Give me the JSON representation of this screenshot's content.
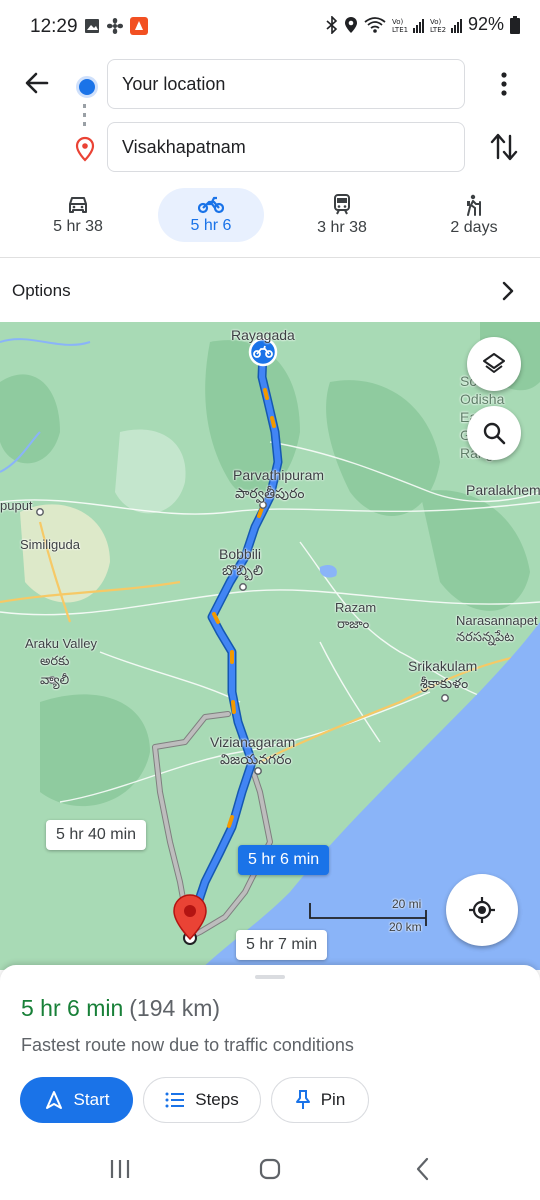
{
  "status_bar": {
    "time": "12:29",
    "battery": "92%",
    "left_icons": [
      "gallery-icon",
      "fan-icon",
      "app-notification-icon"
    ],
    "right_icons": [
      "bluetooth-icon",
      "location-icon",
      "wifi-icon",
      "signal-lte1-icon",
      "signal-lte2-icon",
      "battery-icon"
    ]
  },
  "directions": {
    "origin": "Your location",
    "destination": "Visakhapatnam"
  },
  "modes": [
    {
      "name": "car",
      "icon": "car-icon",
      "time": "5 hr 38",
      "active": false
    },
    {
      "name": "motorcycle",
      "icon": "motorcycle-icon",
      "time": "5 hr 6",
      "active": true
    },
    {
      "name": "transit",
      "icon": "train-icon",
      "time": "3 hr 38",
      "active": false
    },
    {
      "name": "walk",
      "icon": "hiking-icon",
      "time": "2 days",
      "active": false
    }
  ],
  "options": {
    "label": "Options"
  },
  "map": {
    "places": [
      {
        "name": "Rayagada",
        "local": ""
      },
      {
        "name": "Parvathipuram",
        "local": "పార్వతీపురం"
      },
      {
        "name": "Bobbili",
        "local": "బొబ్బిలి"
      },
      {
        "name": "Similiguda",
        "local": ""
      },
      {
        "name": "Araku Valley",
        "local": "అరకు వ్యాలీ"
      },
      {
        "name": "Razam",
        "local": "రాజాం"
      },
      {
        "name": "Narasannapet",
        "local": "నరసన్నపేట"
      },
      {
        "name": "Srikakulam",
        "local": "శ్రీకాకుళం"
      },
      {
        "name": "Vizianagaram",
        "local": "విజయనగరం"
      },
      {
        "name": "Paralakhem",
        "local": ""
      },
      {
        "name": "puput",
        "local": ""
      },
      {
        "name": "South Odisha Eastern Ghats Range",
        "local": ""
      }
    ],
    "route_labels": {
      "alt1": "5 hr 40 min",
      "main": "5 hr 6 min",
      "alt2": "5 hr 7 min"
    },
    "scale": {
      "miles": "20 mi",
      "km": "20 km"
    },
    "colors": {
      "route": "#1a73e8",
      "alt_route": "#9e9e9e",
      "water": "#8ab4f8",
      "land": "#a8dab5",
      "pin": "#ea4335"
    }
  },
  "sheet": {
    "duration": "5 hr 6 min",
    "distance": "(194 km)",
    "reason": "Fastest route now due to traffic conditions",
    "start_label": "Start",
    "steps_label": "Steps",
    "pin_label": "Pin"
  }
}
